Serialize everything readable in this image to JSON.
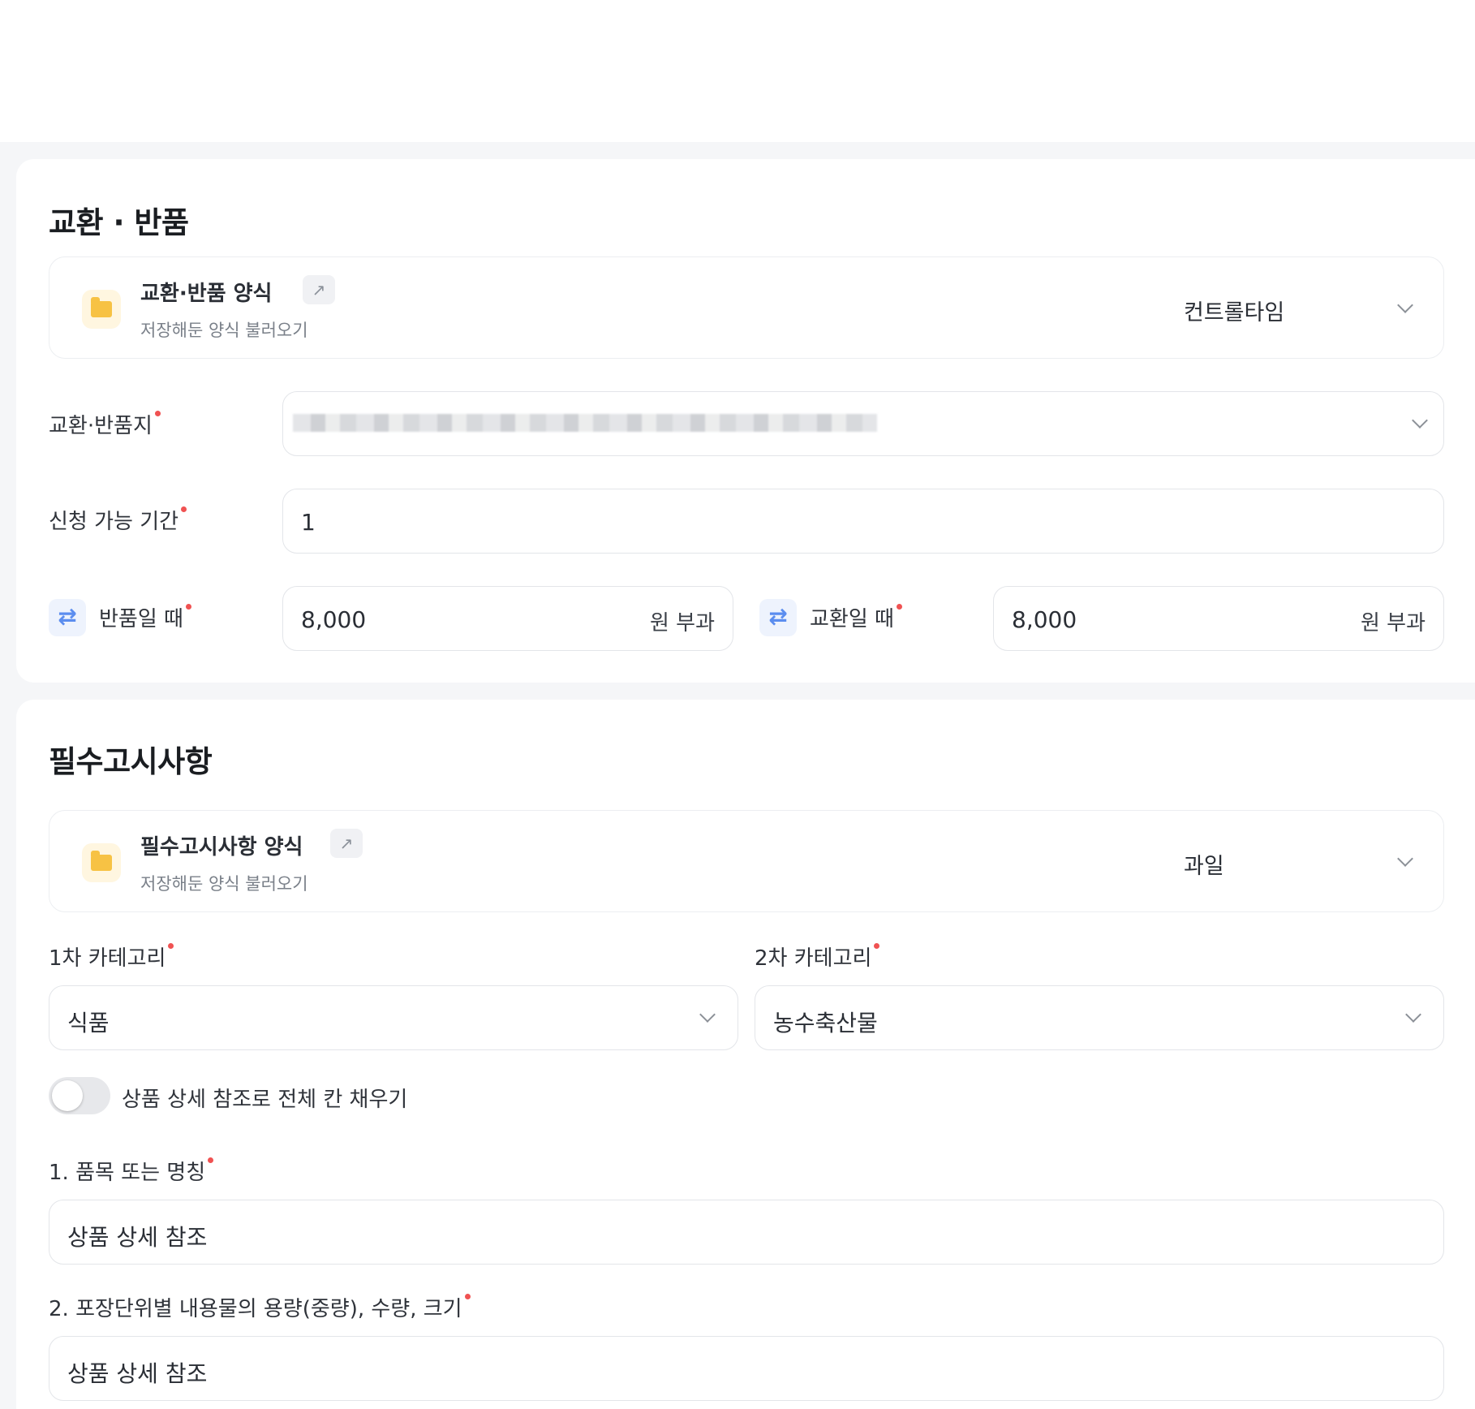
{
  "exchange_return": {
    "section_title": "교환 · 반품",
    "template": {
      "title": "교환·반품 양식",
      "subtitle": "저장해둔 양식 불러오기",
      "selected": "컨트롤타임"
    },
    "address": {
      "label": "교환·반품지"
    },
    "period": {
      "label": "신청 가능 기간",
      "value": "1"
    },
    "return_fee": {
      "label": "반품일 때",
      "value": "8,000",
      "suffix": "원 부과"
    },
    "exchange_fee": {
      "label": "교환일 때",
      "value": "8,000",
      "suffix": "원 부과"
    }
  },
  "notice": {
    "section_title": "필수고시사항",
    "template": {
      "title": "필수고시사항 양식",
      "subtitle": "저장해둔 양식 불러오기",
      "selected": "과일"
    },
    "category1": {
      "label": "1차 카테고리",
      "value": "식품"
    },
    "category2": {
      "label": "2차 카테고리",
      "value": "농수축산물"
    },
    "toggle": {
      "label": "상품 상세 참조로 전체 칸 채우기",
      "on": false
    },
    "item1": {
      "label": "1. 품목 또는 명칭",
      "value": "상품 상세 참조"
    },
    "item2": {
      "label": "2. 포장단위별 내용물의 용량(중량), 수량, 크기",
      "value": "상품 상세 참조"
    }
  },
  "icons": {
    "folder": "folder-icon",
    "external": "external-link-icon",
    "chevron": "chevron-down-icon",
    "swap": "swap-arrows-icon"
  },
  "colors": {
    "required_dot": "#f05252",
    "swap_icon": "#5b8def",
    "folder": "#f7c244"
  }
}
